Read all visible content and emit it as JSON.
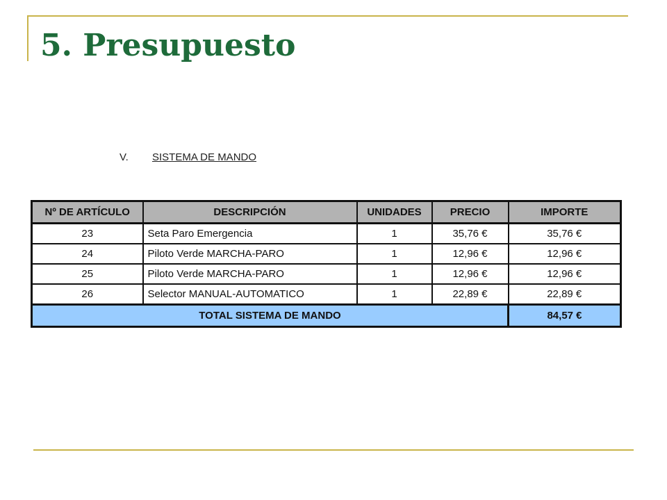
{
  "slide": {
    "title": "5. Presupuesto"
  },
  "section": {
    "number": "V.",
    "heading": "SISTEMA DE MANDO"
  },
  "table": {
    "columns": [
      "Nº DE ARTÍCULO",
      "DESCRIPCIÓN",
      "UNIDADES",
      "PRECIO",
      "IMPORTE"
    ],
    "rows": [
      [
        "23",
        "Seta Paro Emergencia",
        "1",
        "35,76 €",
        "35,76 €"
      ],
      [
        "24",
        "Piloto Verde MARCHA-PARO",
        "1",
        "12,96 €",
        "12,96 €"
      ],
      [
        "25",
        "Piloto Verde MARCHA-PARO",
        "1",
        "12,96 €",
        "12,96 €"
      ],
      [
        "26",
        "Selector MANUAL-AUTOMATICO",
        "1",
        "22,89 €",
        "22,89 €"
      ]
    ],
    "total_label": "TOTAL SISTEMA DE MANDO",
    "total_value": "84,57 €"
  },
  "colors": {
    "title": "#1e6b3a",
    "frame": "#c9b44a",
    "header_bg": "#b3b3b3",
    "total_bg": "#99ccff"
  }
}
